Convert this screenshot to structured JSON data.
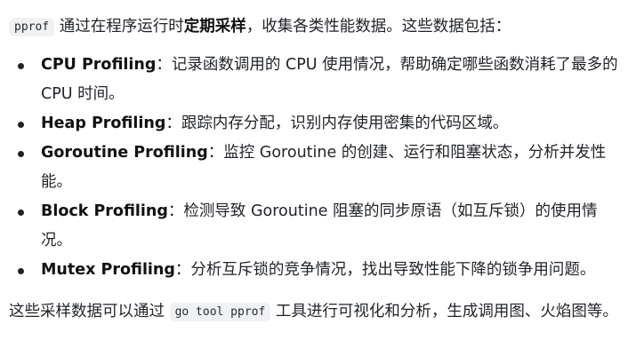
{
  "intro": {
    "code": "pprof",
    "text_before_bold": " 通过在程序运行时",
    "bold": "定期采样",
    "text_after_bold": "，收集各类性能数据。这些数据包括："
  },
  "items": [
    {
      "term": "CPU Profiling",
      "desc": "：记录函数调用的 CPU 使用情况，帮助确定哪些函数消耗了最多的 CPU 时间。"
    },
    {
      "term": "Heap Profiling",
      "desc": "：跟踪内存分配，识别内存使用密集的代码区域。"
    },
    {
      "term": "Goroutine Profiling",
      "desc": "：监控 Goroutine 的创建、运行和阻塞状态，分析并发性能。"
    },
    {
      "term": "Block Profiling",
      "desc": "：检测导致 Goroutine 阻塞的同步原语（如互斥锁）的使用情况。"
    },
    {
      "term": "Mutex Profiling",
      "desc": "：分析互斥锁的竞争情况，找出导致性能下降的锁争用问题。"
    }
  ],
  "outro": {
    "text_before_code": "这些采样数据可以通过 ",
    "code": "go tool pprof",
    "text_after_code": " 工具进行可视化和分析，生成调用图、火焰图等。"
  }
}
